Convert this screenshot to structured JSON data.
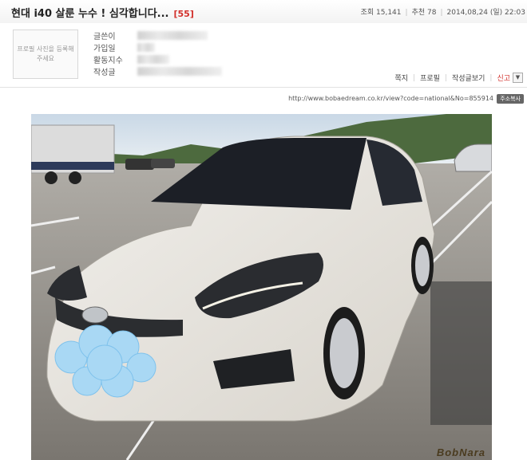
{
  "post": {
    "title": "현대 i40 살룬 누수 ! 심각합니다...",
    "comment_count": "[55]",
    "views_label": "조회",
    "views": "15,141",
    "recommend_label": "추천",
    "recommend": "78",
    "date": "2014,08,24 (일) 22:03"
  },
  "profile": {
    "photo_placeholder": "프로필 사진을 등록해주세요",
    "labels": [
      "글쓴이",
      "가입일",
      "활동지수",
      "작성글"
    ]
  },
  "actions": {
    "message": "쪽지",
    "profile": "프로필",
    "posts": "작성글보기",
    "report": "신고",
    "dropdown_glyph": "▼"
  },
  "source": {
    "url": "http://www.bobaedream.co.kr/view?code=national&No=855914",
    "copy_button": "주소복사"
  },
  "image": {
    "watermark": "BobNara"
  }
}
